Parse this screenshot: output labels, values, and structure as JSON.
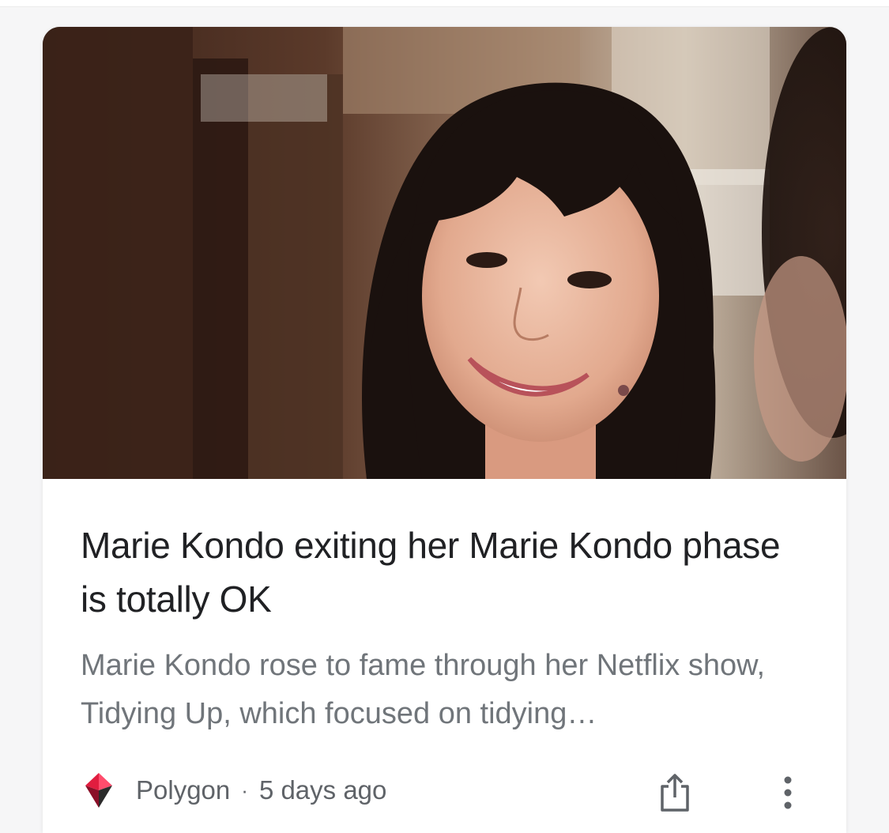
{
  "article": {
    "headline": "Marie Kondo exiting her Marie Kondo phase is totally OK",
    "snippet": "Marie Kondo rose to fame through her Netflix show, Tidying Up, which focused on tidying…",
    "source": "Polygon",
    "separator": "·",
    "age": "5 days ago"
  },
  "icons": {
    "source_logo": "polygon-logo-icon",
    "share": "share-icon",
    "more": "more-vert-icon"
  },
  "colors": {
    "headline": "#202124",
    "snippet": "#70757a",
    "meta": "#5f6368",
    "logo_red": "#e11d3f"
  }
}
